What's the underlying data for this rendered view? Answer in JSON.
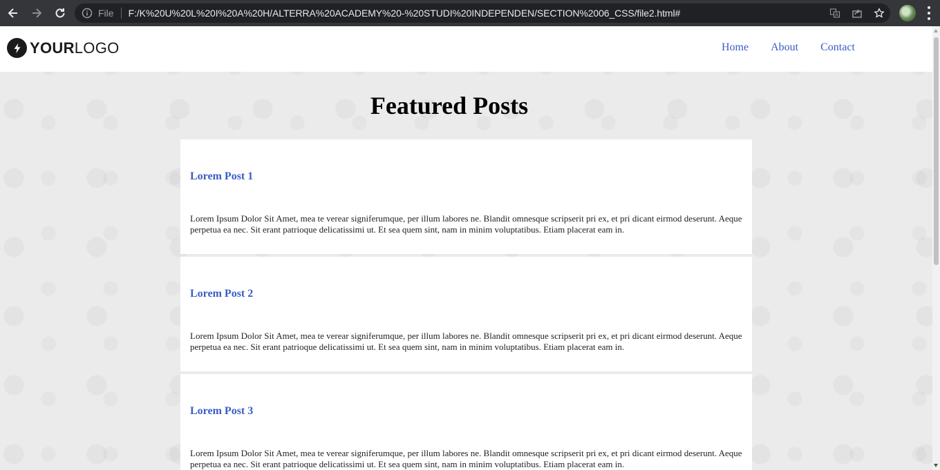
{
  "browser": {
    "file_label": "File",
    "url": "F:/K%20U%20L%20I%20A%20H/ALTERRA%20ACADEMY%20-%20STUDI%20INDEPENDEN/SECTION%2006_CSS/file2.html#"
  },
  "header": {
    "logo_bold": "YOUR",
    "logo_regular": "LOGO",
    "nav": [
      "Home",
      "About",
      "Contact"
    ]
  },
  "main": {
    "title": "Featured Posts",
    "posts": [
      {
        "title": "Lorem Post 1",
        "body": "Lorem Ipsum Dolor Sit Amet, mea te verear signiferumque, per illum labores ne. Blandit omnesque scripserit pri ex, et pri dicant eirmod deserunt. Aeque perpetua ea nec. Sit erant patrioque delicatissimi ut. Et sea quem sint, nam in minim voluptatibus. Etiam placerat eam in."
      },
      {
        "title": "Lorem Post 2",
        "body": "Lorem Ipsum Dolor Sit Amet, mea te verear signiferumque, per illum labores ne. Blandit omnesque scripserit pri ex, et pri dicant eirmod deserunt. Aeque perpetua ea nec. Sit erant patrioque delicatissimi ut. Et sea quem sint, nam in minim voluptatibus. Etiam placerat eam in."
      },
      {
        "title": "Lorem Post 3",
        "body": "Lorem Ipsum Dolor Sit Amet, mea te verear signiferumque, per illum labores ne. Blandit omnesque scripserit pri ex, et pri dicant eirmod deserunt. Aeque perpetua ea nec. Sit erant patrioque delicatissimi ut. Et sea quem sint, nam in minim voluptatibus. Etiam placerat eam in."
      }
    ]
  },
  "colors": {
    "link": "#3a5cc7",
    "chrome": "#35363a",
    "omnibox": "#202124"
  }
}
